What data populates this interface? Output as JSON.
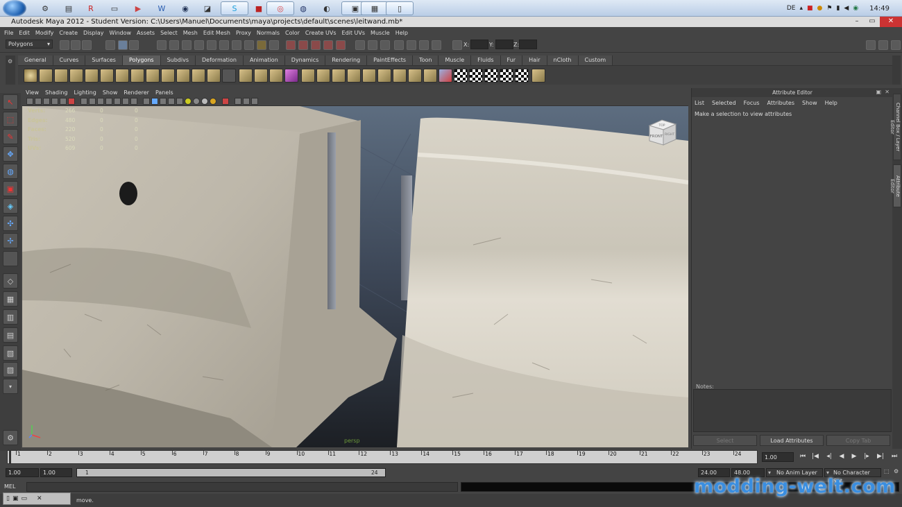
{
  "taskbar": {
    "clock": "14:49",
    "language": "DE"
  },
  "window": {
    "title": "Autodesk Maya 2012 - Student Version: C:\\Users\\Manuel\\Documents\\maya\\projects\\default\\scenes\\leitwand.mb*"
  },
  "menu": [
    "File",
    "Edit",
    "Modify",
    "Create",
    "Display",
    "Window",
    "Assets",
    "Select",
    "Mesh",
    "Edit Mesh",
    "Proxy",
    "Normals",
    "Color",
    "Create UVs",
    "Edit UVs",
    "Muscle",
    "Help"
  ],
  "status_line": {
    "mode": "Polygons",
    "x_label": "X:",
    "y_label": "Y:",
    "z_label": "Z:"
  },
  "shelf": {
    "tabs": [
      "General",
      "Curves",
      "Surfaces",
      "Polygons",
      "Subdivs",
      "Deformation",
      "Animation",
      "Dynamics",
      "Rendering",
      "PaintEffects",
      "Toon",
      "Muscle",
      "Fluids",
      "Fur",
      "Hair",
      "nCloth",
      "Custom"
    ],
    "selected_tab": "Polygons"
  },
  "viewport": {
    "menu": [
      "View",
      "Shading",
      "Lighting",
      "Show",
      "Renderer",
      "Panels"
    ],
    "hud": [
      {
        "label": "Verts:",
        "v1": "266",
        "v2": "0",
        "v3": "0"
      },
      {
        "label": "Edges:",
        "v1": "480",
        "v2": "0",
        "v3": "0"
      },
      {
        "label": "Faces:",
        "v1": "220",
        "v2": "0",
        "v3": "0"
      },
      {
        "label": "Tris:",
        "v1": "520",
        "v2": "0",
        "v3": "0"
      },
      {
        "label": "UVs:",
        "v1": "609",
        "v2": "0",
        "v3": "0"
      }
    ],
    "camera_label": "persp",
    "viewcube_front": "FRONT",
    "viewcube_right": "RIGHT",
    "viewcube_top": "TOP"
  },
  "attribute_editor": {
    "title": "Attribute Editor",
    "menu": [
      "List",
      "Selected",
      "Focus",
      "Attributes",
      "Show",
      "Help"
    ],
    "hint": "Make a selection to view attributes",
    "notes_label": "Notes:",
    "buttons": {
      "select": "Select",
      "load": "Load Attributes",
      "copy": "Copy Tab"
    },
    "side_tabs": {
      "channel": "Channel Box / Layer Editor",
      "attr": "Attribute Editor"
    }
  },
  "timeline": {
    "ticks": [
      "1",
      "2",
      "3",
      "4",
      "5",
      "6",
      "7",
      "8",
      "9",
      "10",
      "11",
      "12",
      "13",
      "14",
      "15",
      "16",
      "17",
      "18",
      "19",
      "20",
      "21",
      "22",
      "23",
      "24"
    ],
    "current_frame": "1.00"
  },
  "range": {
    "start": "1.00",
    "anim_start": "1.00",
    "slider_start": "1",
    "slider_end": "24",
    "anim_end": "24.00",
    "end": "48.00",
    "anim_layer": "No Anim Layer",
    "character_set": "No Character Set"
  },
  "command_line": {
    "label": "MEL",
    "help_text": "move."
  },
  "watermark": "modding-welt.com"
}
